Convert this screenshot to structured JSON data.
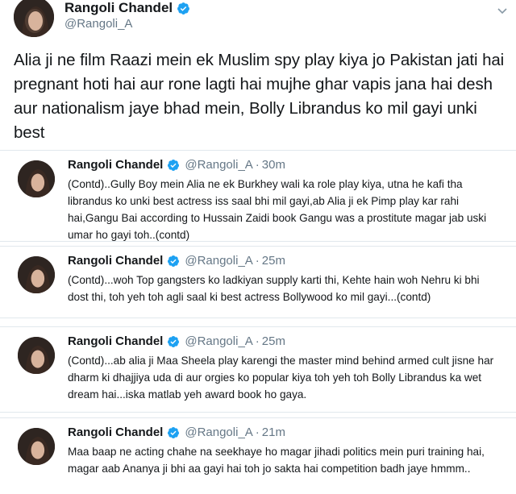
{
  "main_tweet": {
    "name": "Rangoli Chandel",
    "handle": "@Rangoli_A",
    "text": "Alia ji ne film Raazi mein ek Muslim spy play kiya jo Pakistan jati hai pregnant hoti hai aur rone lagti hai mujhe ghar vapis jana hai desh aur nationalism jaye bhad mein, Bolly Librandus ko mil gayi unki best"
  },
  "replies": [
    {
      "name": "Rangoli Chandel",
      "handle": "@Rangoli_A",
      "time": "30m",
      "text": "(Contd)..Gully Boy mein Alia ne ek Burkhey wali ka role play kiya, utna he kafi tha librandus ko unki best actress iss saal bhi mil gayi,ab Alia ji ek Pimp play kar rahi hai,Gangu Bai according to Hussain Zaidi book Gangu was a prostitute magar jab uski umar ho gayi toh..(contd)"
    },
    {
      "name": "Rangoli Chandel",
      "handle": "@Rangoli_A",
      "time": "25m",
      "text": "(Contd)...woh Top gangsters ko ladkiyan supply karti thi, Kehte hain woh Nehru ki bhi dost thi, toh yeh toh agli saal ki best actress Bollywood ko mil gayi...(contd)"
    },
    {
      "name": "Rangoli Chandel",
      "handle": "@Rangoli_A",
      "time": "25m",
      "text": "(Contd)...ab alia ji Maa Sheela play karengi the master mind behind armed cult jisne har dharm ki dhajjiya uda di aur orgies ko popular kiya toh yeh toh Bolly Librandus ka wet dream hai...iska matlab yeh award book ho gaya."
    },
    {
      "name": "Rangoli Chandel",
      "handle": "@Rangoli_A",
      "time": "21m",
      "text": "Maa baap ne acting chahe na seekhaye ho magar jihadi politics mein puri training hai, magar aab Ananya ji bhi aa gayi hai toh jo sakta hai competition badh jaye hmmm.."
    }
  ],
  "colors": {
    "verified": "#1da1f2",
    "separator": "#e6ecf0",
    "muted": "#657786"
  },
  "icons": {
    "verified": "verified-badge-icon",
    "more": "chevron-down-icon"
  }
}
